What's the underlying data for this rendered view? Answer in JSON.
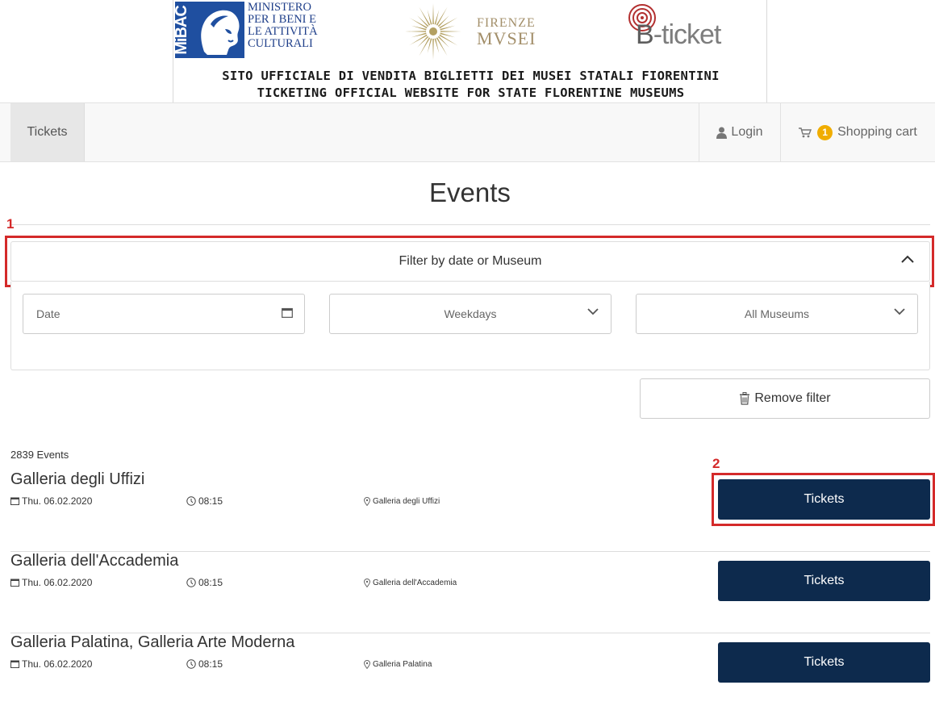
{
  "banner": {
    "mibac_block_text": "MiBAC",
    "mibac_lines": [
      "MINISTERO",
      "PER I BENI E",
      "LE ATTIVITÀ",
      "CULTURALI"
    ],
    "firenze_line1": "FIRENZE",
    "firenze_line2": "MVSEI",
    "bticket_b": "B",
    "bticket_rest": "-ticket",
    "line1": "SITO UFFICIALE DI VENDITA BIGLIETTI DEI MUSEI STATALI FIORENTINI",
    "line2": "TICKETING OFFICIAL WEBSITE FOR STATE FLORENTINE MUSEUMS"
  },
  "nav": {
    "tickets_label": "Tickets",
    "login_label": "Login",
    "cart_count": "1",
    "cart_label": "Shopping cart"
  },
  "page": {
    "title": "Events"
  },
  "annotations": {
    "one": "1",
    "two": "2"
  },
  "filter": {
    "header_label": "Filter by date or Museum",
    "date_placeholder": "Date",
    "weekdays_value": "Weekdays",
    "museums_value": "All Museums",
    "remove_label": "Remove filter"
  },
  "events": {
    "count_label": "2839 Events",
    "items": [
      {
        "title": "Galleria degli Uffizi",
        "date": "Thu. 06.02.2020",
        "time": "08:15",
        "location": "Galleria degli Uffizi",
        "button": "Tickets"
      },
      {
        "title": "Galleria dell'Accademia",
        "date": "Thu. 06.02.2020",
        "time": "08:15",
        "location": "Galleria dell'Accademia",
        "button": "Tickets"
      },
      {
        "title": "Galleria Palatina, Galleria Arte Moderna",
        "date": "Thu. 06.02.2020",
        "time": "08:15",
        "location": "Galleria Palatina",
        "button": "Tickets"
      }
    ]
  },
  "colors": {
    "primary_button": "#0d2a4d",
    "annotation": "#d42a2a",
    "badge": "#f0ad00",
    "mibac_blue": "#1f4fa0",
    "firenze_gold": "#b3a062"
  }
}
